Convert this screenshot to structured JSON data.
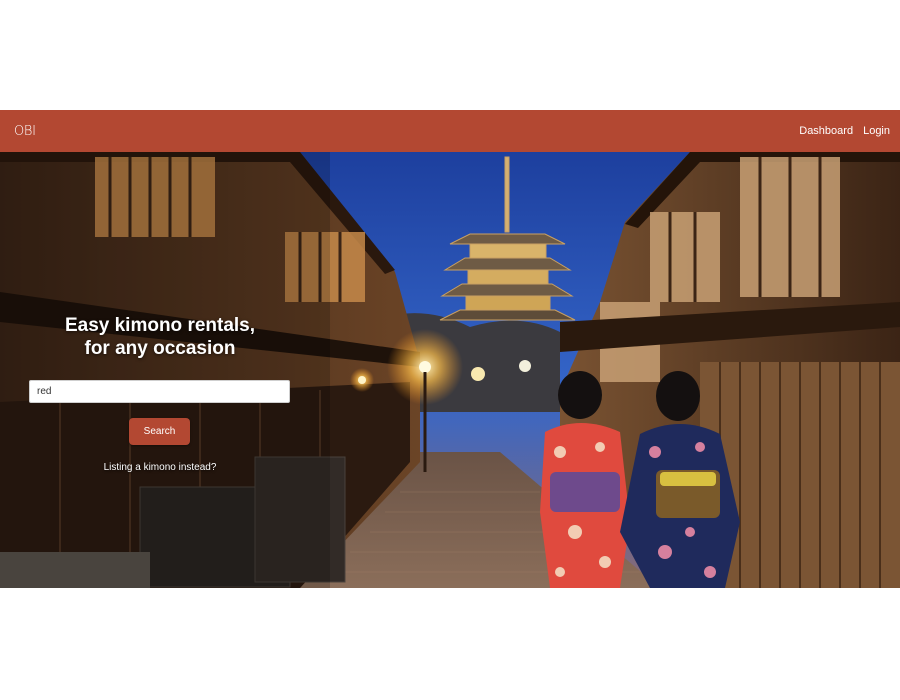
{
  "nav": {
    "logo": "OBI",
    "links": [
      {
        "label": "Dashboard"
      },
      {
        "label": "Login"
      }
    ],
    "background_color": "#b34832"
  },
  "hero": {
    "title_line1": "Easy kimono rentals,",
    "title_line2": "for any occasion",
    "image": "kyoto-street-pagoda-dusk",
    "search": {
      "value": "red",
      "button_label": "Search"
    },
    "secondary_link": "Listing a kimono instead?"
  },
  "colors": {
    "accent": "#b34832",
    "text_light": "#ffffff"
  }
}
